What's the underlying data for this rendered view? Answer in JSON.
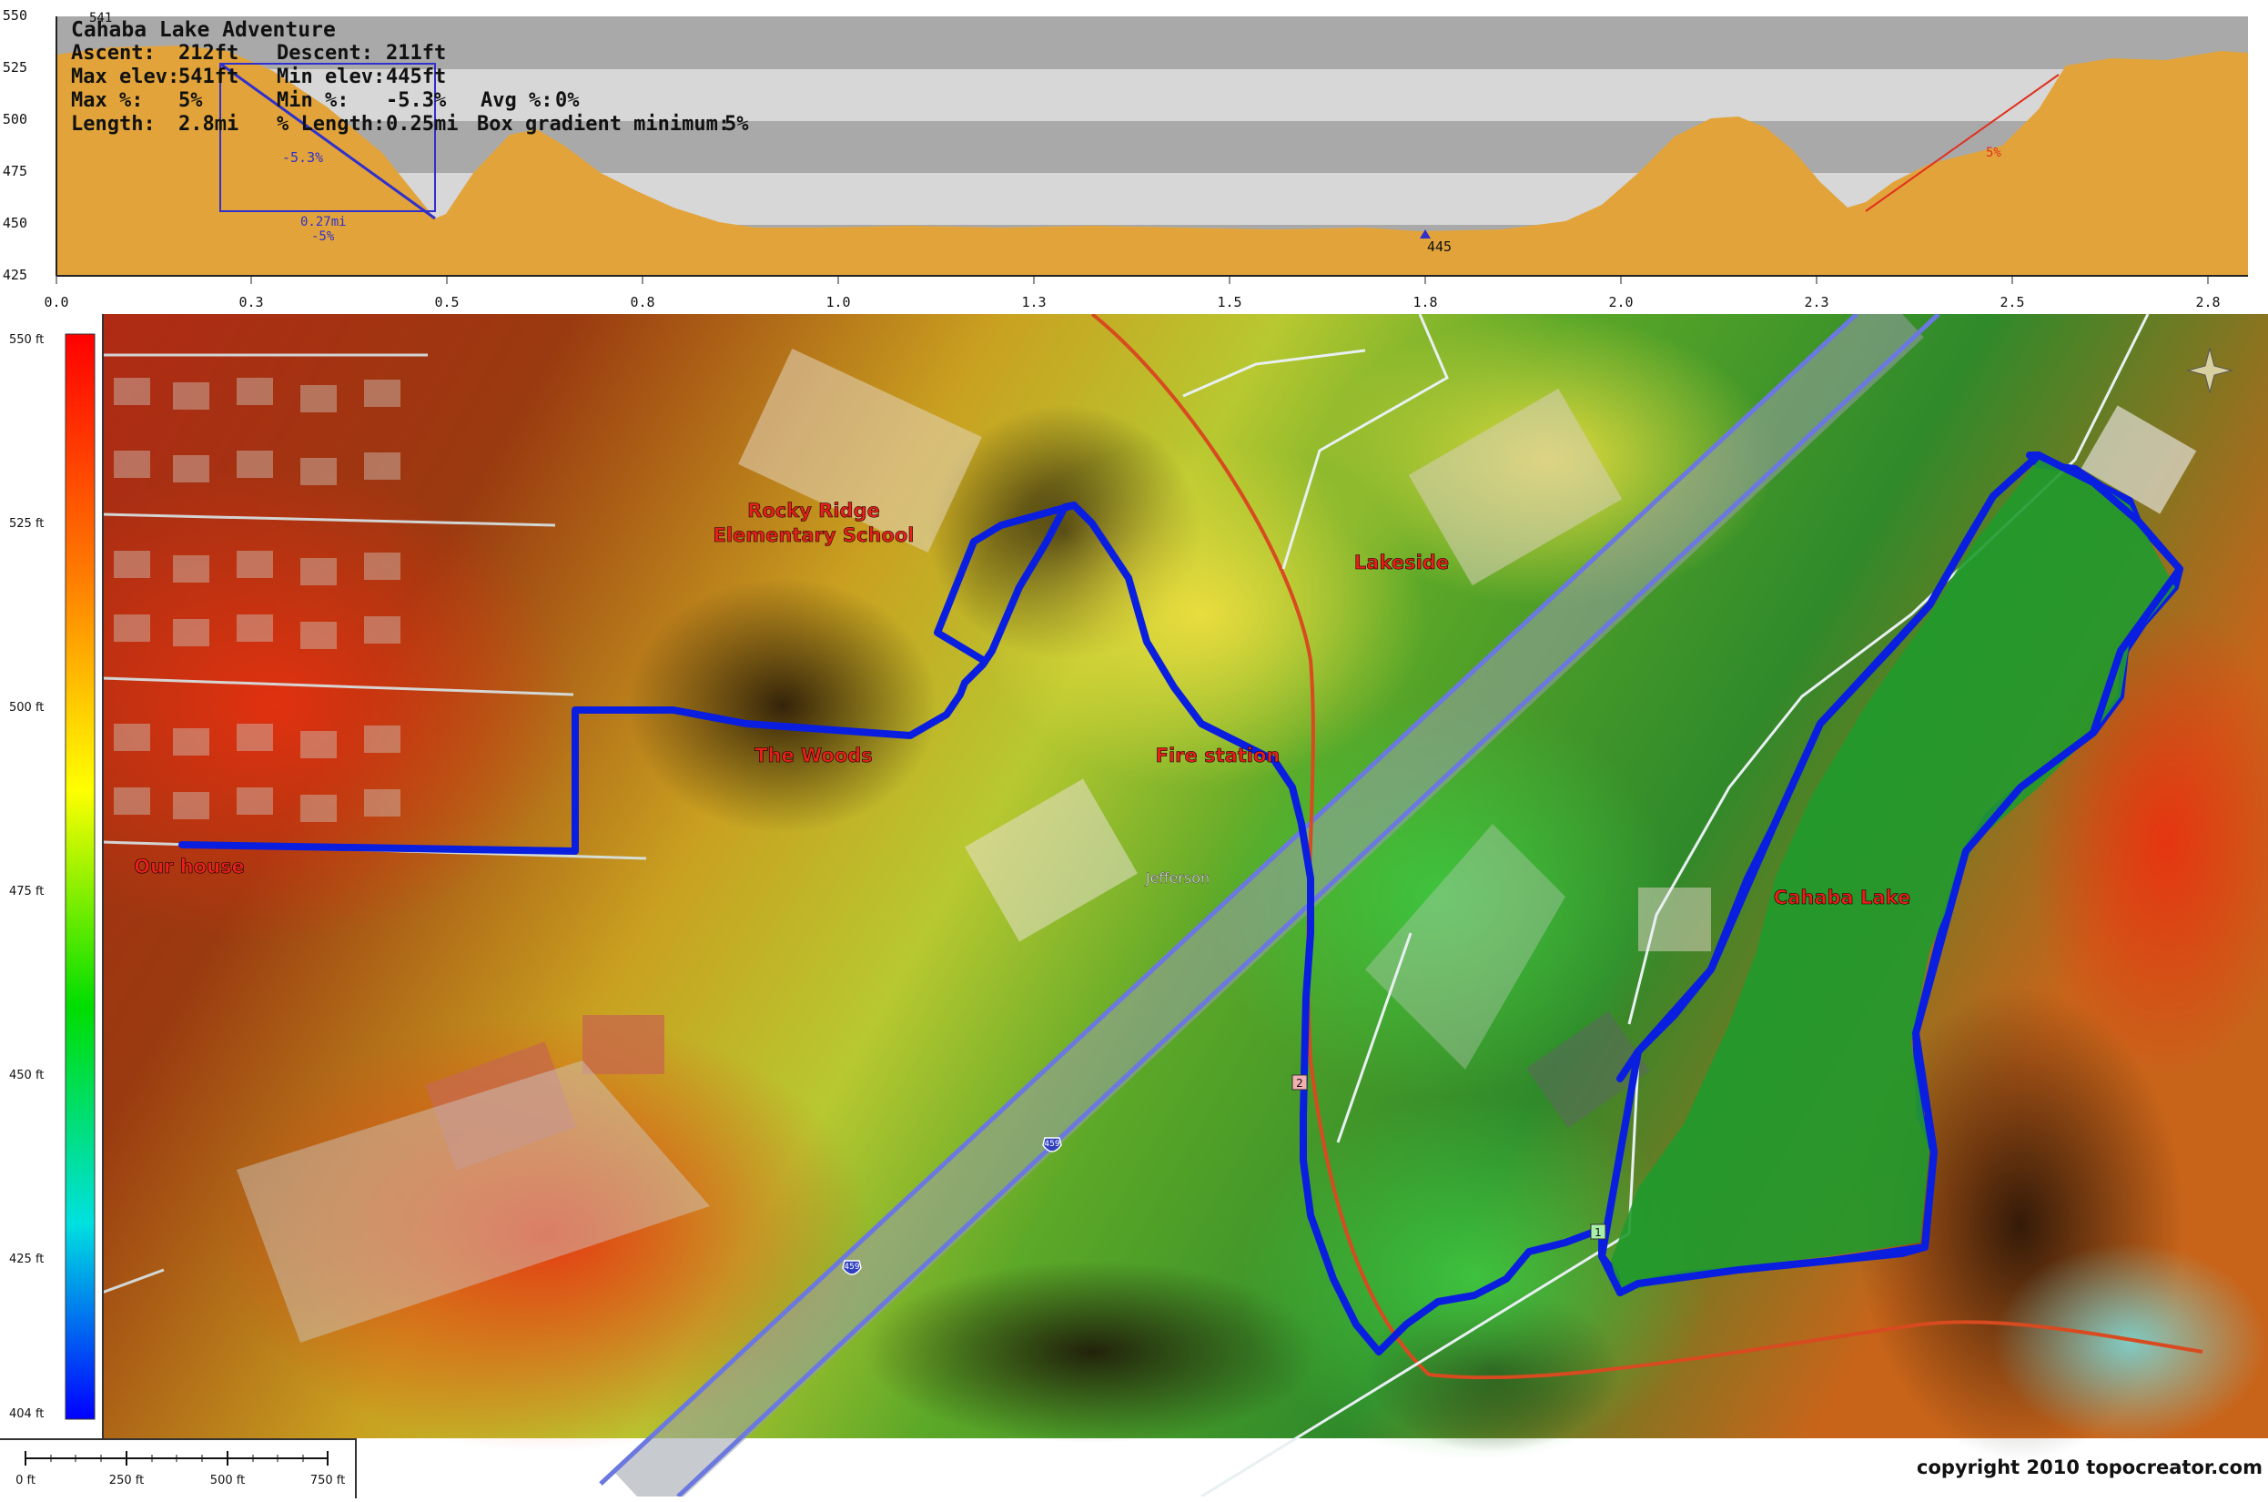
{
  "profile": {
    "title": "Cahaba Lake Adventure",
    "stats": [
      [
        {
          "k": "Ascent:",
          "v": "212ft"
        },
        {
          "k": "Descent:",
          "v": "211ft"
        }
      ],
      [
        {
          "k": "Max elev:",
          "v": "541ft"
        },
        {
          "k": "Min elev:",
          "v": "445ft"
        }
      ],
      [
        {
          "k": "Max %:",
          "v": "5%"
        },
        {
          "k": "Min %:",
          "v": "-5.3%"
        },
        {
          "k": "Avg %:",
          "v": "0%"
        }
      ],
      [
        {
          "k": "Length:",
          "v": "2.8mi"
        },
        {
          "k": "% Length:",
          "v": "0.25mi"
        },
        {
          "k": "Box gradient minimum:",
          "v": "5%"
        }
      ]
    ],
    "max_marker": "541",
    "min_marker": "445",
    "box_grade": "-5.3%",
    "box_length": "0.27mi",
    "box_pct": "-5%",
    "climb_grade": "5%",
    "y_ticks": [
      "550",
      "525",
      "500",
      "475",
      "450",
      "425"
    ],
    "x_ticks": [
      "0.0",
      "0.3",
      "0.5",
      "0.8",
      "1.0",
      "1.3",
      "1.5",
      "1.8",
      "2.0",
      "2.3",
      "2.5",
      "2.8"
    ],
    "fill_color": "#e2a43a"
  },
  "legend": {
    "ticks": [
      "550 ft",
      "525 ft",
      "500 ft",
      "475 ft",
      "450 ft",
      "425 ft",
      "404 ft"
    ]
  },
  "map": {
    "labels": {
      "school": [
        "Rocky Ridge",
        "Elementary School"
      ],
      "woods": "The Woods",
      "fire": "Fire station",
      "house": "Our house",
      "lakeside": "Lakeside",
      "lake": "Cahaba Lake",
      "jefferson": "Jefferson"
    },
    "shields": {
      "i459": "459",
      "r2": "2",
      "r1": "1"
    },
    "route_color": "#0a1ee0"
  },
  "scale": {
    "ticks": [
      "0 ft",
      "250 ft",
      "500 ft",
      "750 ft"
    ]
  },
  "copyright": "copyright 2010 topocreator.com"
}
